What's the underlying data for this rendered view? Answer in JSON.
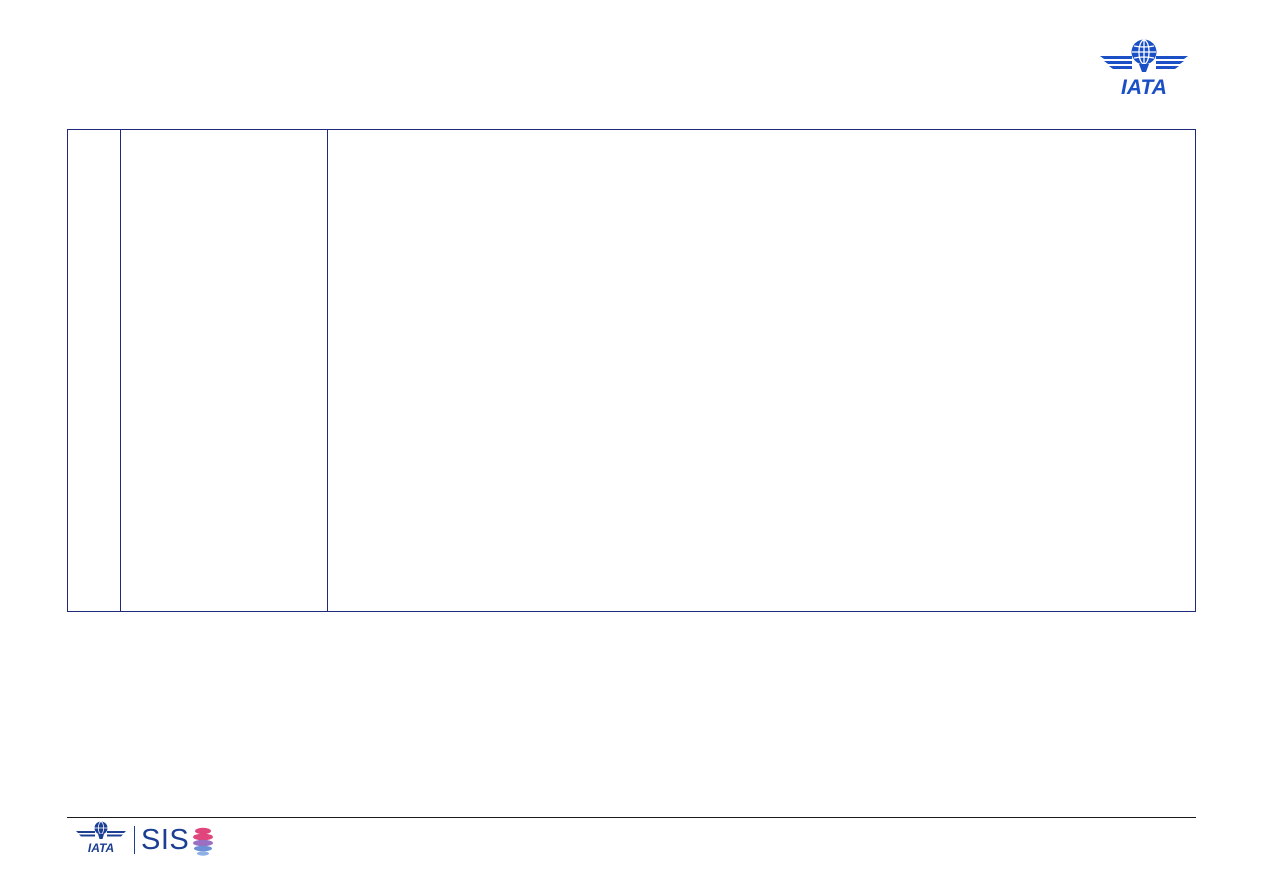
{
  "header": {
    "logo": {
      "icon": "iata-logo-icon",
      "text": "IATA"
    }
  },
  "table": {
    "rows": [
      [
        "",
        "",
        ""
      ]
    ]
  },
  "footer": {
    "iata_logo": {
      "icon": "iata-logo-icon",
      "text": "IATA"
    },
    "product_name": "SIS",
    "swirl_icon": "sis-swirl-icon"
  },
  "colors": {
    "brand_blue": "#1c3f94",
    "iata_blue": "#1a4fc6",
    "table_border": "#1f2a7a",
    "swirl_pink": "#e0457b",
    "swirl_blue": "#6c8fd6"
  }
}
